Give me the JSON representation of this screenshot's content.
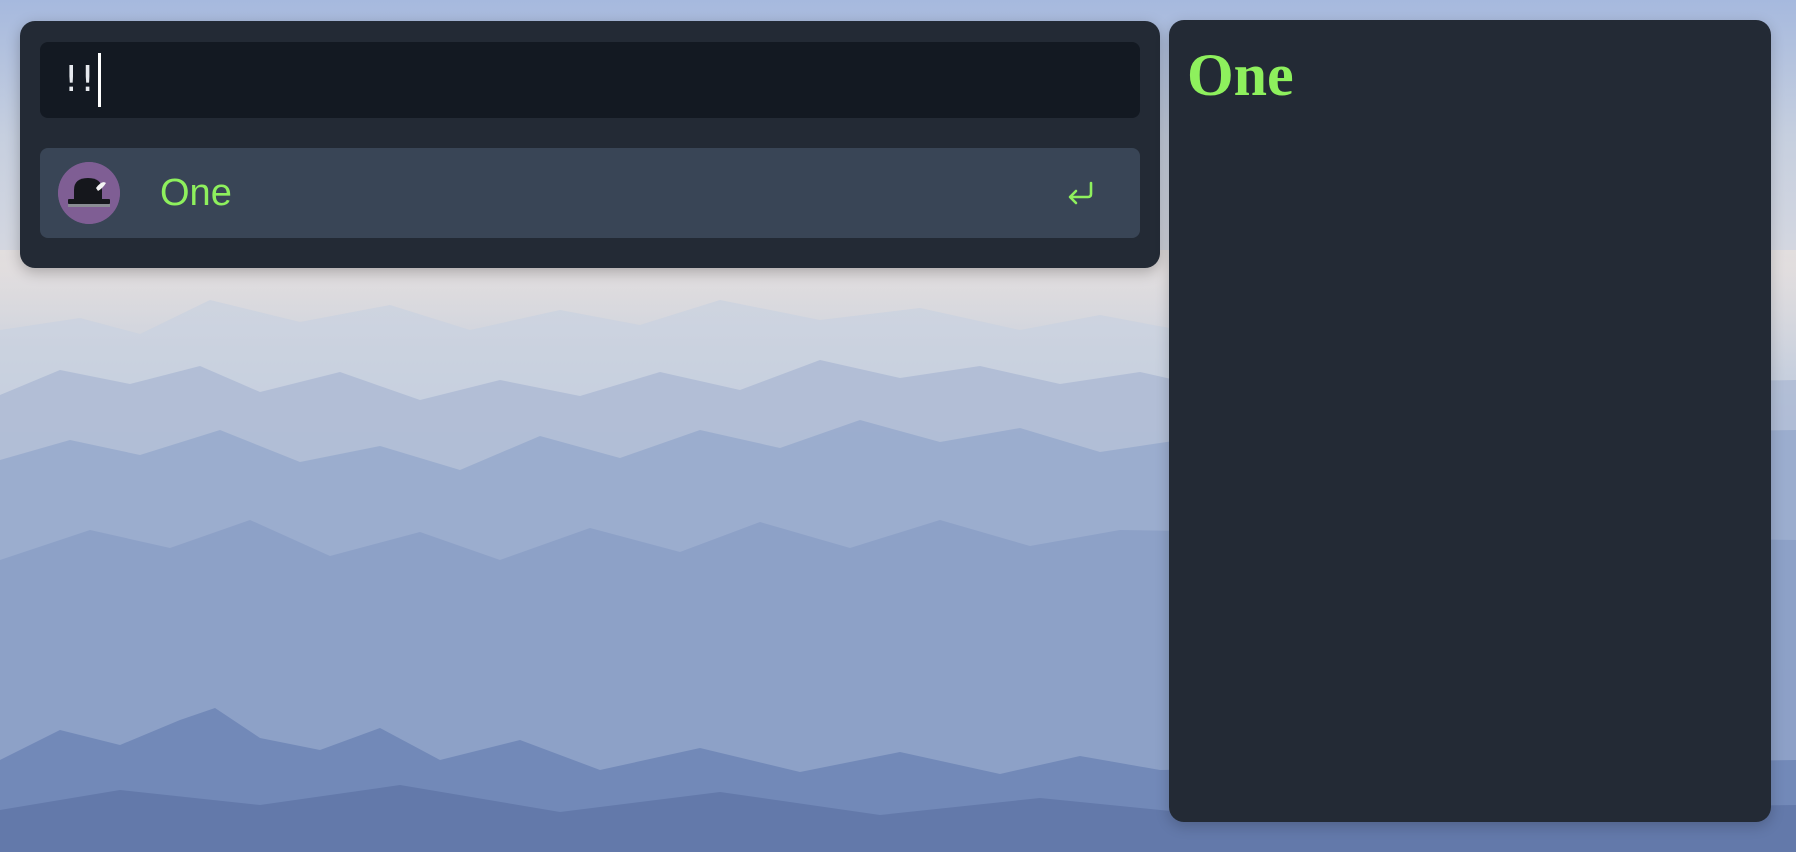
{
  "launcher": {
    "query": "!!",
    "results": [
      {
        "label": "One",
        "action_icon": "enter-return-icon"
      }
    ]
  },
  "preview": {
    "heading": "One"
  },
  "colors": {
    "accent": "#8ef05d",
    "panel": "#232a35",
    "input": "#131922",
    "selected_row": "#394556",
    "avatar": "#7f5e94"
  }
}
